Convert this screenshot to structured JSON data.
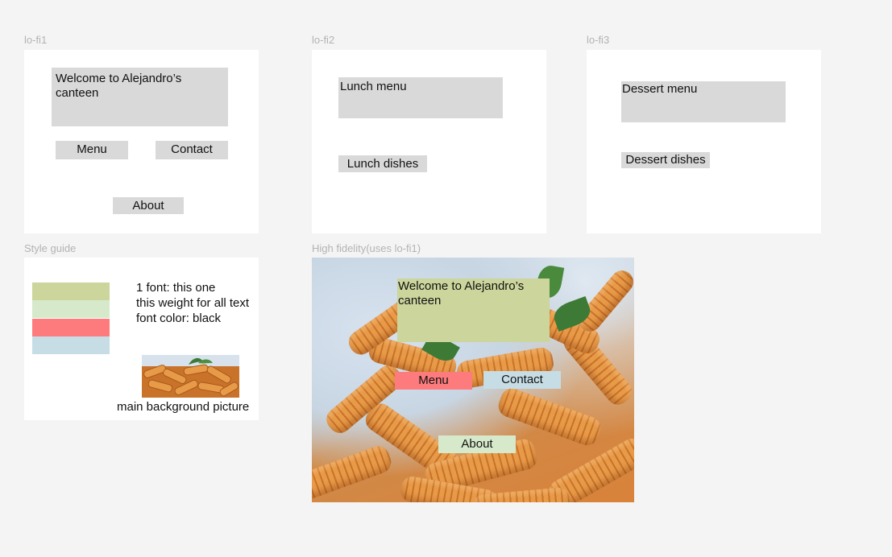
{
  "frames": {
    "lofi1": {
      "label": "lo-fi1",
      "title": "Welcome to Alejandro’s canteen",
      "menu_button": "Menu",
      "contact_button": "Contact",
      "about_button": "About"
    },
    "lofi2": {
      "label": "lo-fi2",
      "title": "Lunch menu",
      "dishes": "Lunch dishes"
    },
    "lofi3": {
      "label": "lo-fi3",
      "title": "Dessert menu",
      "dishes": "Dessert dishes"
    },
    "style_guide": {
      "label": "Style guide",
      "swatches": [
        "#cbd59c",
        "#d6eacb",
        "#fd7b7c",
        "#c6dde5"
      ],
      "font_line1": "1 font: this one",
      "font_line2": "this weight for all text",
      "font_line3": "font color: black",
      "picture_caption": "main background picture"
    },
    "hifi": {
      "label": "High fidelity(uses lo-fi1)",
      "title": "Welcome to Alejandro’s canteen",
      "menu_button": "Menu",
      "contact_button": "Contact",
      "about_button": "About"
    }
  }
}
